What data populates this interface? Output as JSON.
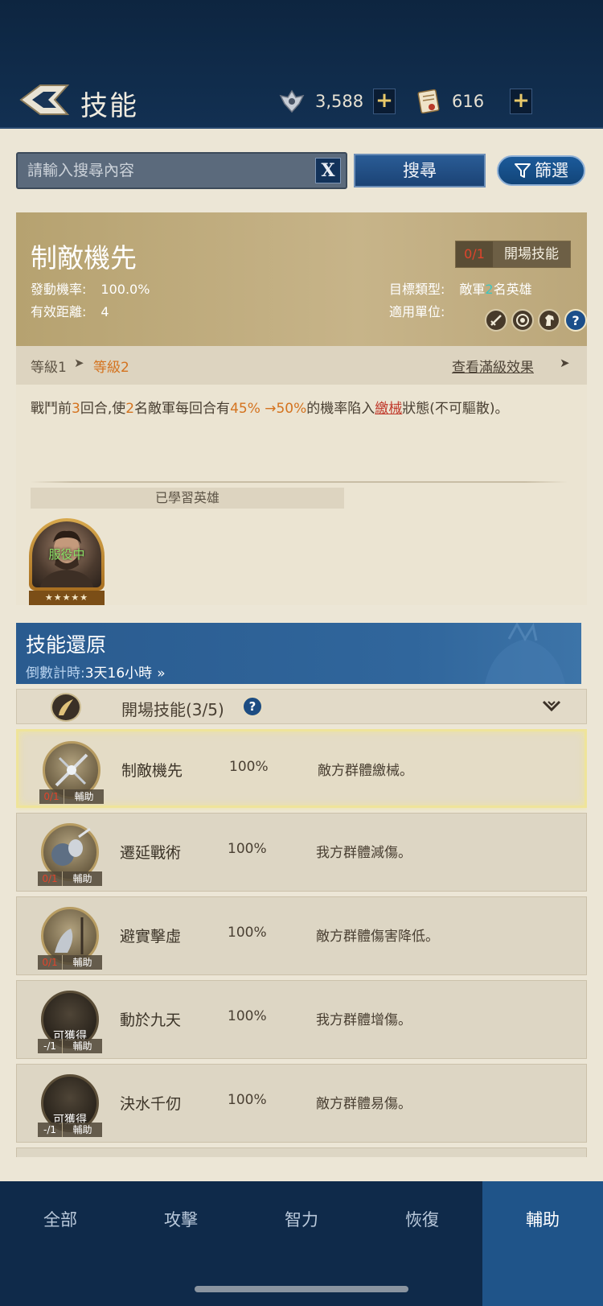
{
  "header": {
    "title": "技能",
    "resources": [
      {
        "icon": "honor-crest-icon",
        "value": "3,588",
        "add": "+"
      },
      {
        "icon": "scroll-icon",
        "value": "616",
        "add": "+"
      }
    ]
  },
  "search": {
    "placeholder": "請輸入搜尋內容",
    "clear_label": "X",
    "search_label": "搜尋",
    "filter_label": "篩選"
  },
  "skill": {
    "name": "制敵機先",
    "slot_count": "0/1",
    "type_tag": "開場技能",
    "trigger_rate_label": "發動機率:",
    "trigger_rate": "100.0%",
    "range_label": "有效距離:",
    "range": "4",
    "target_label": "目標類型:",
    "target_prefix": "敵軍",
    "target_num": "2",
    "target_suffix": "名英雄",
    "units_label": "適用單位:",
    "units": [
      "sword-icon",
      "target-icon",
      "horse-icon",
      "help-icon"
    ],
    "level_from": "等級1",
    "level_to": "等級2",
    "max_effect": "查看滿級效果",
    "desc": {
      "p1": "戰鬥前",
      "n1": "3",
      "p2": "回合,使",
      "n2": "2",
      "p3": "名敵軍每回合有",
      "n3": "45% →50%",
      "p4": "的機率陷入",
      "status": "繳械",
      "p5": "狀態(不可驅散)。"
    },
    "learned_heroes_label": "已學習英雄",
    "hero": {
      "status": "服役中",
      "stars": "★★★★★"
    }
  },
  "restore": {
    "title": "技能還原",
    "countdown_label": "倒數計時:",
    "countdown": "3天16小時",
    "countdown_arrow": "»"
  },
  "category": {
    "label": "開場技能(3/5)",
    "help": "?"
  },
  "skills": [
    {
      "name": "制敵機先",
      "rate": "100%",
      "effect": "敵方群體繳械。",
      "count": "0/1",
      "type": "輔助",
      "available": ""
    },
    {
      "name": "遷延戰術",
      "rate": "100%",
      "effect": "我方群體減傷。",
      "count": "0/1",
      "type": "輔助",
      "available": ""
    },
    {
      "name": "避實擊虛",
      "rate": "100%",
      "effect": "敵方群體傷害降低。",
      "count": "0/1",
      "type": "輔助",
      "available": ""
    },
    {
      "name": "動於九天",
      "rate": "100%",
      "effect": "我方群體增傷。",
      "count": "-/1",
      "type": "輔助",
      "available": "可獲得"
    },
    {
      "name": "決水千仞",
      "rate": "100%",
      "effect": "敵方群體易傷。",
      "count": "-/1",
      "type": "輔助",
      "available": "可獲得"
    }
  ],
  "tabs": [
    "全部",
    "攻擊",
    "智力",
    "恢復",
    "輔助"
  ],
  "active_tab": "輔助"
}
